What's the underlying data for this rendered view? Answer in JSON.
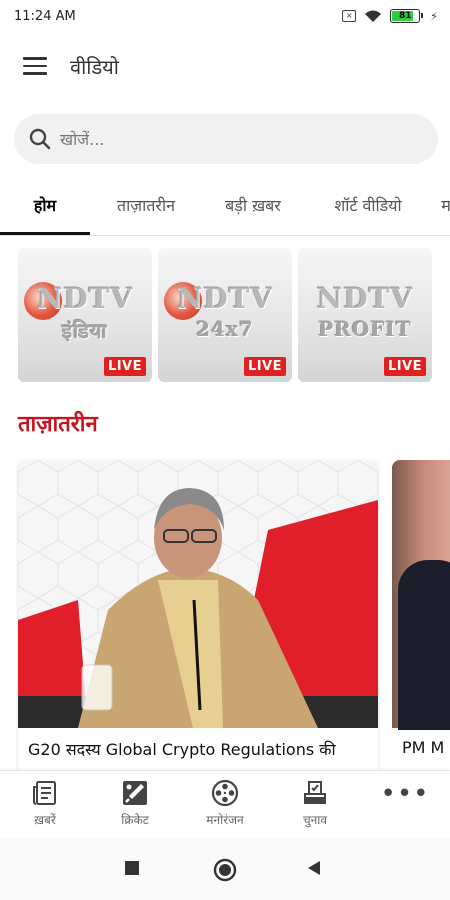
{
  "status_bar": {
    "time": "11:24 AM",
    "battery_level": "81",
    "battery_fraction": 0.81
  },
  "app_bar": {
    "title": "वीडियो"
  },
  "search": {
    "placeholder": "खोजें..."
  },
  "tabs": [
    {
      "label": "होम",
      "active": true
    },
    {
      "label": "ताज़ातरीन",
      "active": false
    },
    {
      "label": "बड़ी ख़बर",
      "active": false
    },
    {
      "label": "शॉर्ट वीडियो",
      "active": false
    },
    {
      "label": "म",
      "active": false
    }
  ],
  "live_channels": [
    {
      "logo": "NDTV",
      "logo_sub": "इंडिया",
      "badge": "LIVE"
    },
    {
      "logo": "NDTV",
      "logo_sub": "24x7",
      "badge": "LIVE"
    },
    {
      "logo": "NDTV",
      "logo_sub": "PROFIT",
      "badge": "LIVE"
    }
  ],
  "section": {
    "title": "ताज़ातरीन"
  },
  "videos": [
    {
      "caption": "G20 सदस्य Global Crypto Regulations की"
    },
    {
      "caption": "PM M"
    }
  ],
  "bottom_nav": [
    {
      "label": "ख़बरें",
      "icon": "newspaper-icon"
    },
    {
      "label": "क्रिकेट",
      "icon": "cricket-bat-icon"
    },
    {
      "label": "मनोरंजन",
      "icon": "film-reel-icon"
    },
    {
      "label": "चुनाव",
      "icon": "ballot-box-icon"
    },
    {
      "label": "",
      "icon": "more-icon"
    }
  ],
  "colors": {
    "accent_red": "#c7131e",
    "live_red": "#e12020"
  }
}
